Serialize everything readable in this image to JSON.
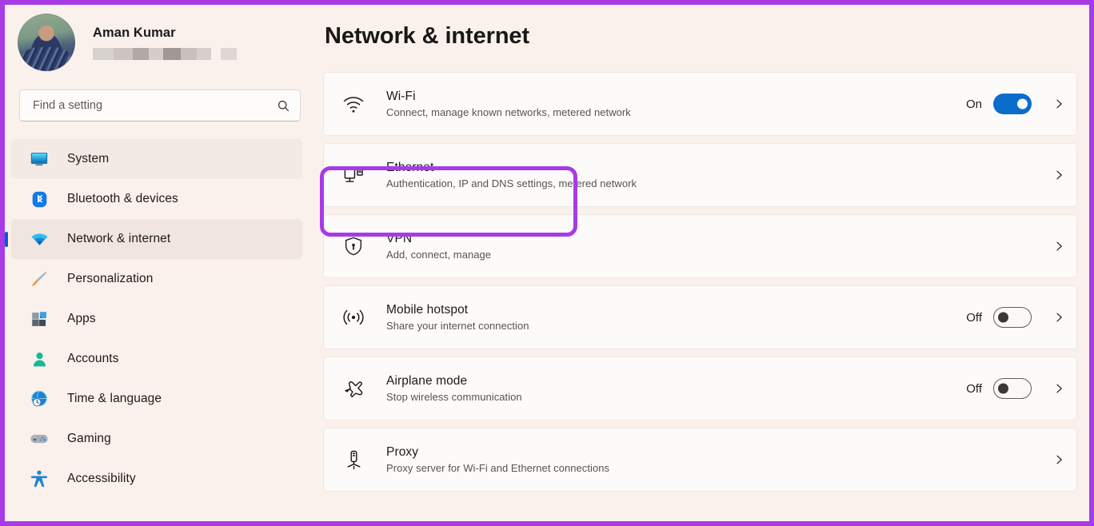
{
  "accent": {
    "annotation_purple": "#a83ae8",
    "toggle_on_blue": "#0a6ccb",
    "nav_indicator_blue": "#0a5dc2",
    "page_background": "#faf0ec",
    "card_background": "#fdfbfa"
  },
  "profile": {
    "name": "Aman Kumar",
    "email_redacted": "",
    "avatar": "user-photo-avatar"
  },
  "search": {
    "placeholder": "Find a setting",
    "value": "",
    "icon": "search-icon"
  },
  "sidebar": {
    "items": [
      {
        "label": "System",
        "icon": "monitor-icon",
        "selected": false,
        "hover": true
      },
      {
        "label": "Bluetooth & devices",
        "icon": "bluetooth-icon",
        "selected": false,
        "hover": false
      },
      {
        "label": "Network & internet",
        "icon": "wifi-icon",
        "selected": true,
        "hover": false
      },
      {
        "label": "Personalization",
        "icon": "paintbrush-icon",
        "selected": false,
        "hover": false
      },
      {
        "label": "Apps",
        "icon": "apps-blocks-icon",
        "selected": false,
        "hover": false
      },
      {
        "label": "Accounts",
        "icon": "person-icon",
        "selected": false,
        "hover": false
      },
      {
        "label": "Time & language",
        "icon": "clock-globe-icon",
        "selected": false,
        "hover": false
      },
      {
        "label": "Gaming",
        "icon": "gamepad-icon",
        "selected": false,
        "hover": false
      },
      {
        "label": "Accessibility",
        "icon": "accessibility-icon",
        "selected": false,
        "hover": false
      }
    ]
  },
  "main": {
    "title": "Network & internet",
    "rows": [
      {
        "title": "Wi-Fi",
        "subtitle": "Connect, manage known networks, metered network",
        "icon": "wifi-signal-icon",
        "toggle": {
          "present": true,
          "state_label": "On",
          "on": true
        },
        "chevron": true,
        "highlighted": false
      },
      {
        "title": "Ethernet",
        "subtitle": "Authentication, IP and DNS settings, metered network",
        "icon": "ethernet-icon",
        "toggle": {
          "present": false,
          "state_label": "",
          "on": false
        },
        "chevron": true,
        "highlighted": false
      },
      {
        "title": "VPN",
        "subtitle": "Add, connect, manage",
        "icon": "shield-lock-icon",
        "toggle": {
          "present": false,
          "state_label": "",
          "on": false
        },
        "chevron": true,
        "highlighted": true
      },
      {
        "title": "Mobile hotspot",
        "subtitle": "Share your internet connection",
        "icon": "hotspot-broadcast-icon",
        "toggle": {
          "present": true,
          "state_label": "Off",
          "on": false
        },
        "chevron": true,
        "highlighted": false
      },
      {
        "title": "Airplane mode",
        "subtitle": "Stop wireless communication",
        "icon": "airplane-icon",
        "toggle": {
          "present": true,
          "state_label": "Off",
          "on": false
        },
        "chevron": true,
        "highlighted": false
      },
      {
        "title": "Proxy",
        "subtitle": "Proxy server for Wi-Fi and Ethernet connections",
        "icon": "proxy-server-icon",
        "toggle": {
          "present": false,
          "state_label": "",
          "on": false
        },
        "chevron": true,
        "highlighted": false
      }
    ]
  }
}
